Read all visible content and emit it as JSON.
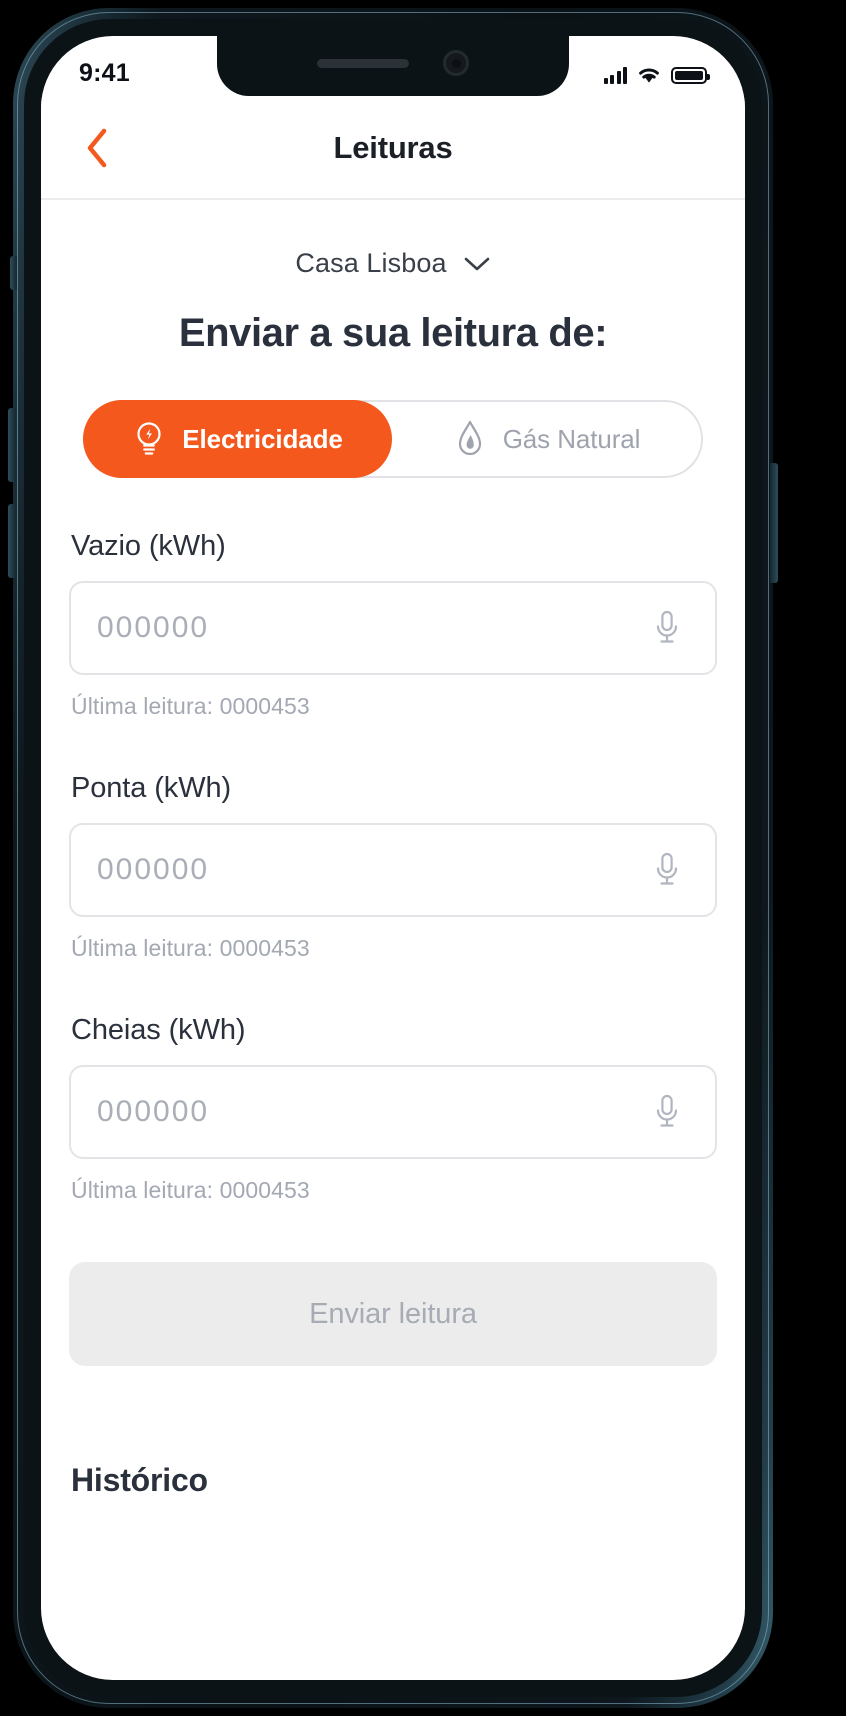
{
  "status_bar": {
    "time": "9:41",
    "cellular_icon": "cellular-bars-icon",
    "wifi_icon": "wifi-icon",
    "battery_icon": "battery-full-icon"
  },
  "nav": {
    "back_icon": "chevron-left-icon",
    "title": "Leituras"
  },
  "house_selector": {
    "name": "Casa Lisboa",
    "chevron_icon": "chevron-down-icon"
  },
  "heading": "Enviar a sua leitura de:",
  "segmented_control": {
    "options": [
      {
        "label": "Electricidade",
        "icon": "lightbulb-icon",
        "active": true
      },
      {
        "label": "Gás Natural",
        "icon": "flame-icon",
        "active": false
      }
    ]
  },
  "fields": [
    {
      "label": "Vazio (kWh)",
      "value": "",
      "placeholder": "000000",
      "hint": "Última leitura: 0000453",
      "mic_icon": "microphone-icon"
    },
    {
      "label": "Ponta (kWh)",
      "value": "",
      "placeholder": "000000",
      "hint": "Última leitura: 0000453",
      "mic_icon": "microphone-icon"
    },
    {
      "label": "Cheias (kWh)",
      "value": "",
      "placeholder": "000000",
      "hint": "Última leitura: 0000453",
      "mic_icon": "microphone-icon"
    }
  ],
  "submit_button": {
    "label": "Enviar leitura",
    "enabled": false
  },
  "history": {
    "title": "Histórico"
  },
  "colors": {
    "accent": "#F4581C",
    "text_primary": "#2B313C",
    "text_muted": "#A3A8B2",
    "border": "#E4E4E8",
    "disabled_bg": "#ECECED"
  }
}
